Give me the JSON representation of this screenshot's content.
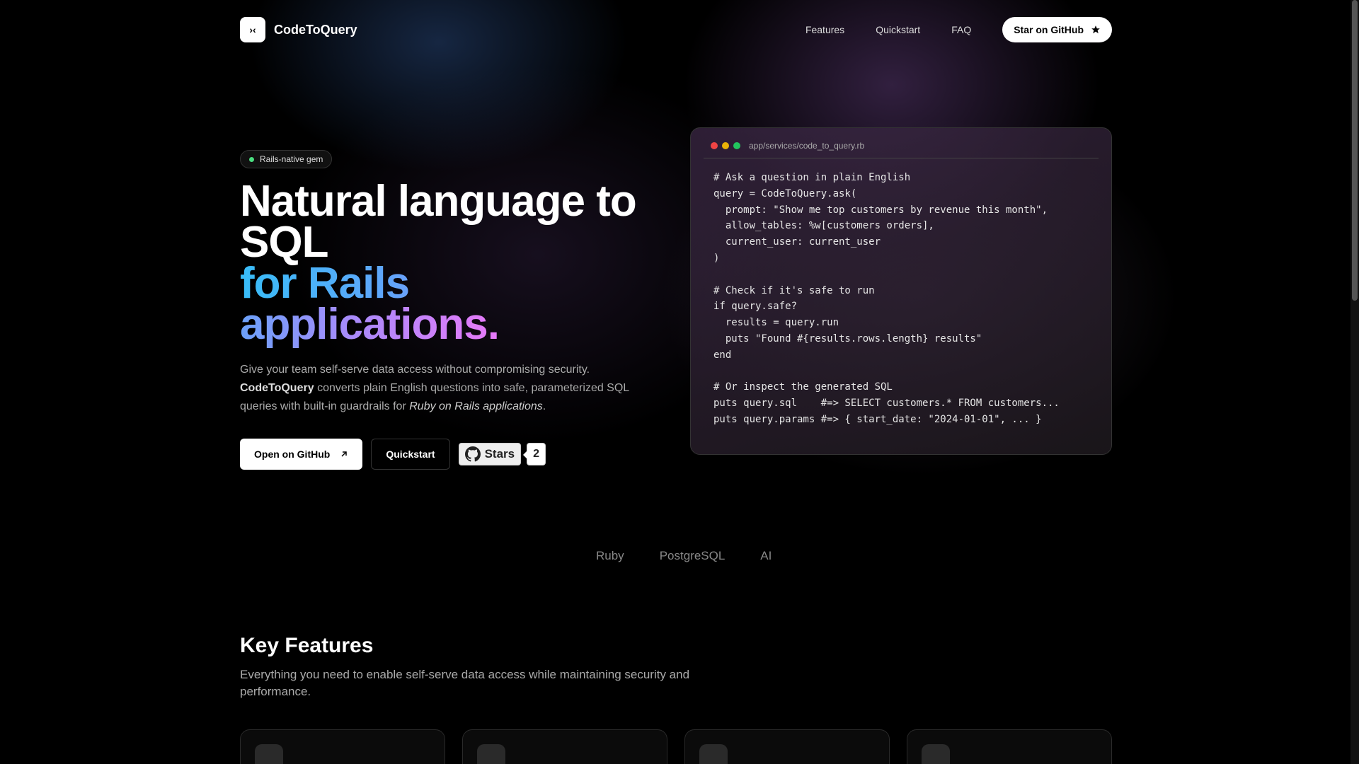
{
  "header": {
    "brand": "CodeToQuery",
    "logo_glyph": "›‹",
    "nav": [
      "Features",
      "Quickstart",
      "FAQ"
    ],
    "star_label": "Star on GitHub"
  },
  "hero": {
    "badge": "Rails-native gem",
    "title_line1": "Natural language to",
    "title_line2": "SQL",
    "title_line3": "for Rails applications.",
    "lede_part1": "Give your team self-serve data access without compromising security.",
    "lede_brand": "CodeToQuery",
    "lede_part2": "converts plain English questions into safe, parameterized SQL queries with built-in guardrails for",
    "lede_italic": "Ruby on Rails applications",
    "lede_end": ".",
    "cta_primary": "Open on GitHub",
    "cta_secondary": "Quickstart",
    "gh_stars_label": "Stars",
    "gh_stars_count": "2"
  },
  "code": {
    "path": "app/services/code_to_query.rb",
    "traffic_colors": [
      "#ef4444",
      "#eab308",
      "#22c55e"
    ],
    "lines": [
      "# Ask a question in plain English",
      "query = CodeToQuery.ask(",
      "  prompt: \"Show me top customers by revenue this month\",",
      "  allow_tables: %w[customers orders],",
      "  current_user: current_user",
      ")",
      "",
      "# Check if it's safe to run",
      "if query.safe?",
      "  results = query.run",
      "  puts \"Found #{results.rows.length} results\"",
      "end",
      "",
      "# Or inspect the generated SQL",
      "puts query.sql    #=> SELECT customers.* FROM customers...",
      "puts query.params #=> { start_date: \"2024-01-01\", ... }"
    ]
  },
  "tech": [
    "Ruby",
    "PostgreSQL",
    "AI"
  ],
  "features": {
    "title": "Key Features",
    "subtitle": "Everything you need to enable self-serve data access while maintaining security and performance."
  }
}
